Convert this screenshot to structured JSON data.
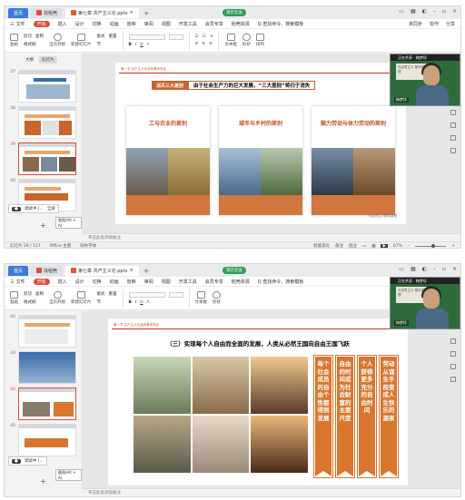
{
  "tabs": {
    "home": "首页",
    "shell": "找稻壳",
    "doc": "第七章 共产主义论.pptx"
  },
  "share_badge": "演示云会",
  "menu": {
    "file": "三 文件",
    "items": [
      "开始",
      "插入",
      "设计",
      "切换",
      "动画",
      "放映",
      "审阅",
      "视图",
      "开发工具",
      "会员专享",
      "稻壳资源"
    ],
    "selected": "开始",
    "search": "Q 查找命令、搜索模板",
    "right": [
      "未同步",
      "协作",
      "分享"
    ]
  },
  "ribbon": {
    "paste": "粘贴",
    "cut": "剪切",
    "copy": "复制",
    "format_painter": "格式刷",
    "from_current": "当页开始",
    "new_slide": "新建幻灯片",
    "layout": "版式",
    "section": "节",
    "reset": "重置",
    "text_box": "文本框",
    "shape": "形状",
    "arrange": "排列"
  },
  "sidebar": {
    "tabs": [
      "大纲",
      "幻灯片"
    ],
    "w1_numbers": [
      "37",
      "38",
      "39",
      "40"
    ],
    "w2_numbers": [
      "42",
      "43",
      "44",
      "45"
    ],
    "add_label": "+",
    "tooltip_label": "调试中 [...",
    "tooltip_btn": "全屏",
    "hint": "截图(Alt + A)"
  },
  "slide1": {
    "header_left": "第一节  共产主义社会的基本特征",
    "header_right": "专题",
    "pill_left": "消灭三大差别",
    "pill_right": "由于社会生产力的巨大发展，“三大差别”将归于消失",
    "cards": [
      "工与农业的差别",
      "城市与乡村的差别",
      "脑力劳动与体力劳动的差别"
    ],
    "footer": "马克思主义基本原理"
  },
  "slide2": {
    "header_left": "第一节  共产主义社会的基本特征",
    "title": "（三）实现每个人自由而全面的发展，人类从必然王国向自由王国飞跃",
    "bars": [
      "每个社会成员的自由个性都得到发展",
      "自由的时间成为社会财富的主要尺度",
      "个人获得更多充分的自由时间",
      "劳动从谋生手段变成人生快乐的源泉"
    ]
  },
  "video": {
    "caption": "正在共享 · 梅梦珍",
    "board_text": "马克思主义 基本原理",
    "name": "梅梦珍"
  },
  "notes": "单击此处添加备注",
  "status": {
    "slide": "幻灯片 39 / 117",
    "theme": "Office 主题",
    "font": "缺失字体",
    "smart": "智能美化",
    "notes_btn": "备注",
    "comment_btn": "批注",
    "zoom": "67%"
  },
  "colors": {
    "accent": "#e2483d",
    "orange": "#d1763e",
    "bar_orange": "#d9752c",
    "home_tab": "#3b7bd9"
  }
}
